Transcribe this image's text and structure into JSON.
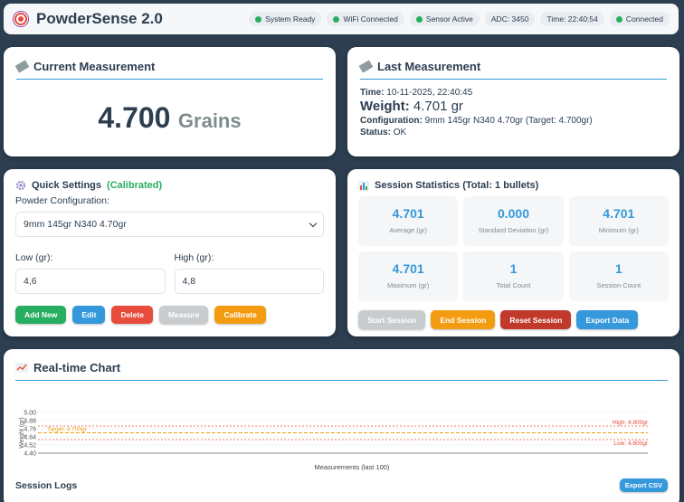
{
  "header": {
    "title": "PowderSense 2.0",
    "status_items": [
      {
        "label": "System Ready",
        "dot": true
      },
      {
        "label": "WiFi Connected",
        "dot": true
      },
      {
        "label": "Sensor Active",
        "dot": true
      },
      {
        "label": "ADC: 3450",
        "dot": false
      },
      {
        "label": "Time: 22:40:54",
        "dot": false
      },
      {
        "label": "Connected",
        "dot": true
      }
    ]
  },
  "current": {
    "title": "Current Measurement",
    "value": "4.700",
    "unit": "Grains"
  },
  "last": {
    "title": "Last Measurement",
    "time_label": "Time:",
    "time_value": "10-11-2025, 22:40:45",
    "weight_label": "Weight:",
    "weight_value": "4.701 gr",
    "config_label": "Configuration:",
    "config_value": "9mm 145gr N340 4.70gr (Target: 4.700gr)",
    "status_label": "Status:",
    "status_value": "OK"
  },
  "settings": {
    "title": "Quick Settings",
    "calibrated": "(Calibrated)",
    "config_label": "Powder Configuration:",
    "config_selected": "9mm 145gr N340 4.70gr",
    "low_label": "Low (gr):",
    "low_value": "4,6",
    "high_label": "High (gr):",
    "high_value": "4,8",
    "buttons": {
      "add": "Add New",
      "edit": "Edit",
      "delete": "Delete",
      "measure": "Measure",
      "calibrate": "Calibrate"
    }
  },
  "stats": {
    "title": "Session Statistics (Total: 1 bullets)",
    "items": [
      {
        "value": "4.701",
        "label": "Average (gr)"
      },
      {
        "value": "0.000",
        "label": "Standard Deviation (gr)"
      },
      {
        "value": "4.701",
        "label": "Minimum (gr)"
      },
      {
        "value": "4.701",
        "label": "Maximum (gr)"
      },
      {
        "value": "1",
        "label": "Total Count"
      },
      {
        "value": "1",
        "label": "Session Count"
      }
    ],
    "buttons": {
      "start": "Start Session",
      "end": "End Session",
      "reset": "Reset Session",
      "export": "Export Data"
    }
  },
  "chart": {
    "title": "Real-time Chart",
    "logs_title": "Session Logs",
    "export_csv": "Export CSV"
  },
  "chart_data": {
    "type": "line",
    "xlabel": "Measurements (last 100)",
    "ylabel": "Weight (gr)",
    "ylim": [
      4.4,
      5.0
    ],
    "yticks": [
      "5.00",
      "4.88",
      "4.76",
      "4.64",
      "4.52",
      "4.40"
    ],
    "series": [],
    "reference_lines": [
      {
        "label": "Target: 4.700gr",
        "value": 4.7,
        "color": "#f39c12"
      },
      {
        "label": "High: 4.800gr",
        "value": 4.8,
        "color": "#e74c3c"
      },
      {
        "label": "Low: 4.600gr",
        "value": 4.6,
        "color": "#e74c3c"
      }
    ]
  }
}
